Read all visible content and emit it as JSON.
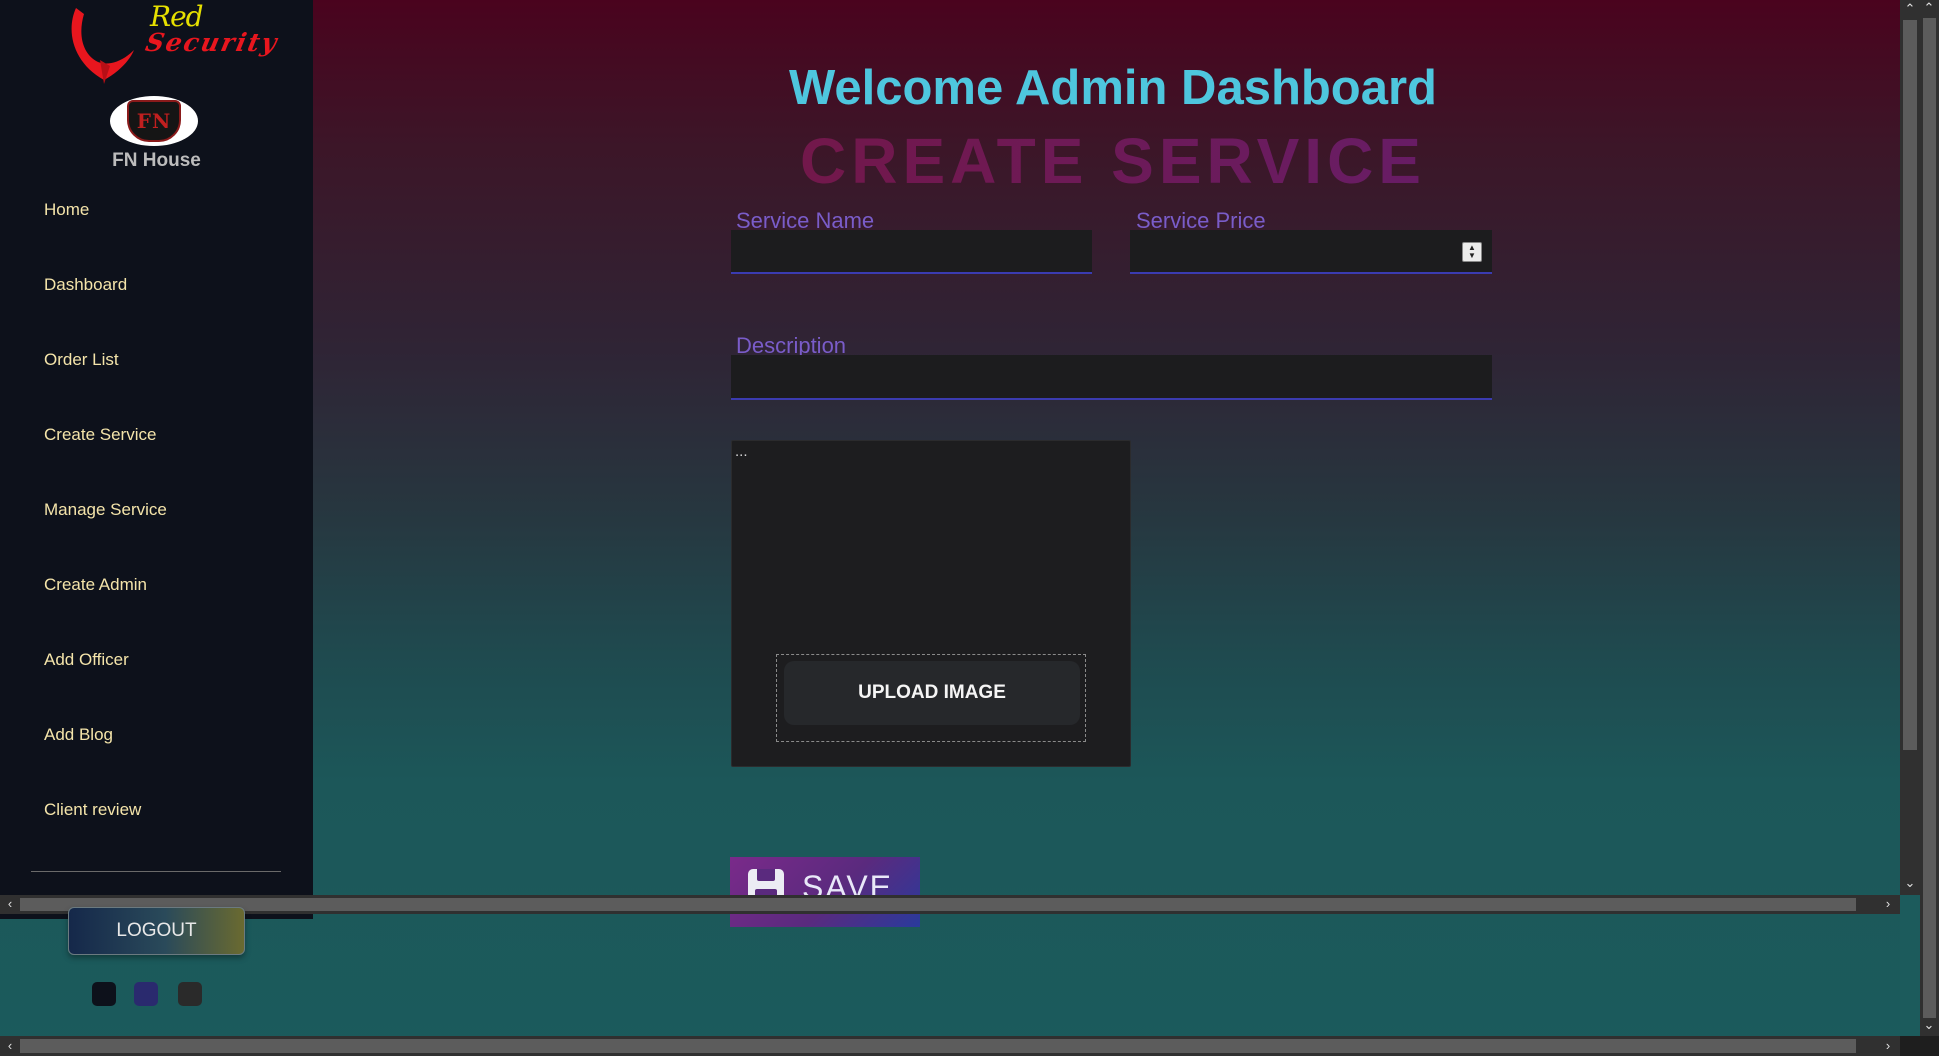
{
  "brand": {
    "logo_top_text": "Red",
    "logo_bottom_text": "Security",
    "badge_initials": "FN",
    "org_name": "FN House"
  },
  "nav": {
    "items": [
      {
        "label": "Home"
      },
      {
        "label": "Dashboard"
      },
      {
        "label": "Order List"
      },
      {
        "label": "Create Service"
      },
      {
        "label": "Manage Service"
      },
      {
        "label": "Create Admin"
      },
      {
        "label": "Add Officer"
      },
      {
        "label": "Add Blog"
      },
      {
        "label": "Client review"
      }
    ]
  },
  "header": {
    "welcome": "Welcome Admin Dashboard",
    "title": "CREATE SERVICE"
  },
  "form": {
    "service_name_label": "Service Name",
    "service_name_value": "",
    "service_price_label": "Service Price",
    "service_price_value": "",
    "description_label": "Description",
    "description_value": "",
    "image_preview_placeholder": "...",
    "upload_label": "UPLOAD IMAGE",
    "save_label": "SAVE"
  },
  "footer": {
    "logout_label": "LOGOUT",
    "theme_swatches": [
      "#0d111b",
      "#2a2a6e",
      "#2a2a2a"
    ]
  },
  "colors": {
    "accent_welcome": "#4ec6de",
    "label": "#7a5cc9",
    "nav_text": "#f4e4aa",
    "sidebar_bg": "#0d111b"
  }
}
